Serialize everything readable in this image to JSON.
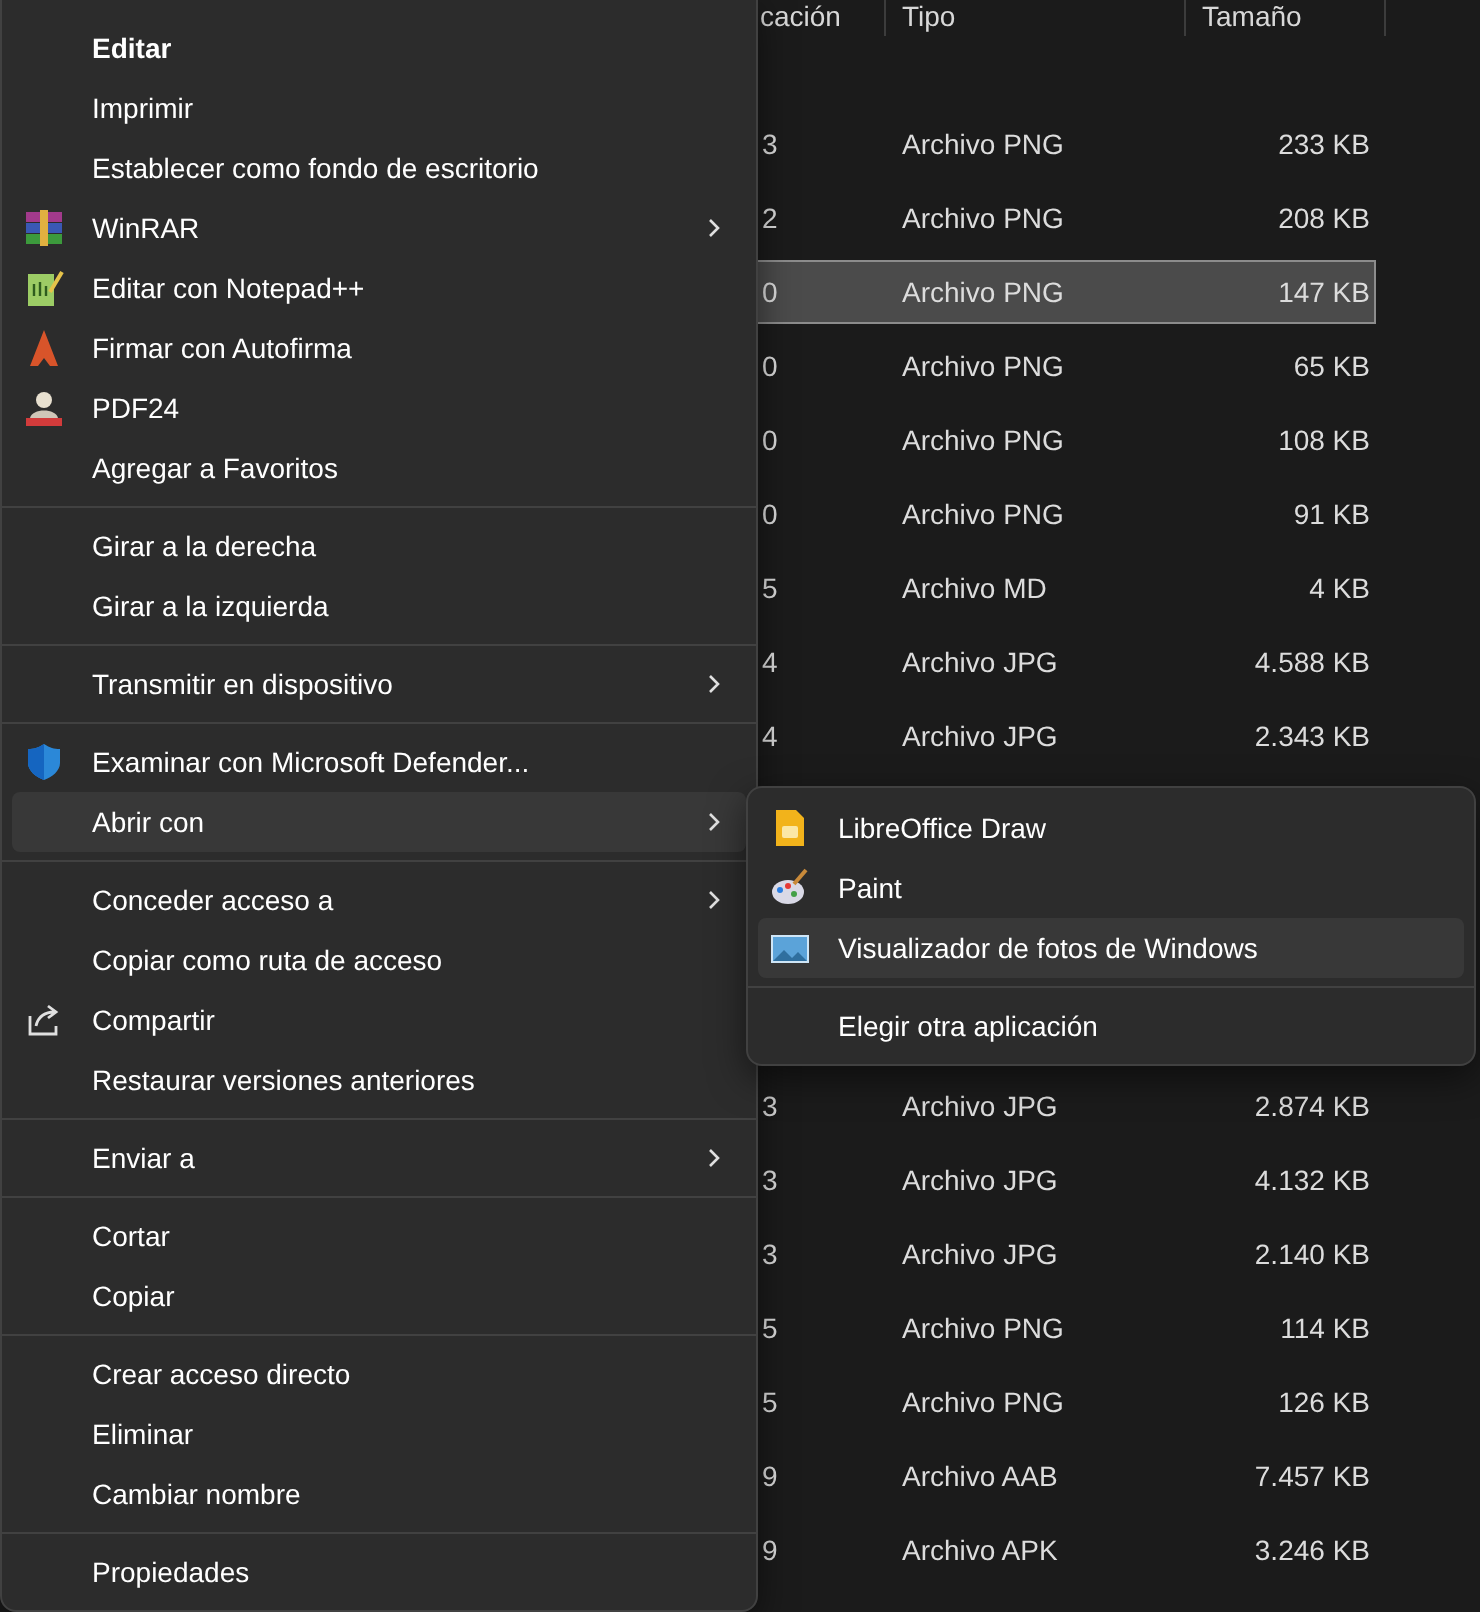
{
  "file_list": {
    "columns": [
      "cación",
      "Tipo",
      "Tamaño"
    ],
    "rows": [
      {
        "column_1": "3",
        "type": "Archivo PNG",
        "size": "233 KB",
        "selected": false
      },
      {
        "column_1": "2",
        "type": "Archivo PNG",
        "size": "208 KB",
        "selected": false
      },
      {
        "column_1": "0",
        "type": "Archivo PNG",
        "size": "147 KB",
        "selected": true
      },
      {
        "column_1": "0",
        "type": "Archivo PNG",
        "size": "65 KB",
        "selected": false
      },
      {
        "column_1": "0",
        "type": "Archivo PNG",
        "size": "108 KB",
        "selected": false
      },
      {
        "column_1": "0",
        "type": "Archivo PNG",
        "size": "91 KB",
        "selected": false
      },
      {
        "column_1": "5",
        "type": "Archivo MD",
        "size": "4 KB",
        "selected": false
      },
      {
        "column_1": "4",
        "type": "Archivo JPG",
        "size": "4.588 KB",
        "selected": false
      },
      {
        "column_1": "4",
        "type": "Archivo JPG",
        "size": "2.343 KB",
        "selected": false
      },
      {
        "column_1": "3",
        "type": "Archivo JPG",
        "size": "2.874 KB",
        "selected": false
      },
      {
        "column_1": "3",
        "type": "Archivo JPG",
        "size": "4.132 KB",
        "selected": false
      },
      {
        "column_1": "3",
        "type": "Archivo JPG",
        "size": "2.140 KB",
        "selected": false
      },
      {
        "column_1": "5",
        "type": "Archivo PNG",
        "size": "114 KB",
        "selected": false
      },
      {
        "column_1": "5",
        "type": "Archivo PNG",
        "size": "126 KB",
        "selected": false
      },
      {
        "column_1": "9",
        "type": "Archivo AAB",
        "size": "7.457 KB",
        "selected": false
      },
      {
        "column_1": "9",
        "type": "Archivo APK",
        "size": "3.246 KB",
        "selected": false
      }
    ]
  },
  "context_menu": {
    "groups": [
      [
        {
          "label": "Editar",
          "kind": "text",
          "bold": true,
          "has_submenu": false,
          "selected": false
        },
        {
          "label": "Imprimir",
          "kind": "text",
          "bold": false,
          "has_submenu": false,
          "selected": false
        },
        {
          "label": "Establecer como fondo de escritorio",
          "kind": "text",
          "bold": false,
          "has_submenu": false,
          "selected": false
        },
        {
          "label": "WinRAR",
          "kind": "icon",
          "bold": false,
          "has_submenu": true,
          "selected": false
        },
        {
          "label": "Editar con Notepad++",
          "kind": "icon",
          "bold": false,
          "has_submenu": false,
          "selected": false
        },
        {
          "label": "Firmar con Autofirma",
          "kind": "icon",
          "bold": false,
          "has_submenu": false,
          "selected": false
        },
        {
          "label": "PDF24",
          "kind": "icon",
          "bold": false,
          "has_submenu": false,
          "selected": false
        },
        {
          "label": "Agregar a Favoritos",
          "kind": "text",
          "bold": false,
          "has_submenu": false,
          "selected": false
        }
      ],
      [
        {
          "label": "Girar a la derecha",
          "kind": "text",
          "bold": false,
          "has_submenu": false,
          "selected": false
        },
        {
          "label": "Girar a la izquierda",
          "kind": "text",
          "bold": false,
          "has_submenu": false,
          "selected": false
        }
      ],
      [
        {
          "label": "Transmitir en dispositivo",
          "kind": "text",
          "bold": false,
          "has_submenu": true,
          "selected": false
        }
      ],
      [
        {
          "label": "Examinar con Microsoft Defender...",
          "kind": "icon",
          "bold": false,
          "has_submenu": false,
          "selected": false
        },
        {
          "label": "Abrir con",
          "kind": "text",
          "bold": false,
          "has_submenu": true,
          "selected": true,
          "children": [
            [
              {
                "label": "LibreOffice Draw",
                "kind": "icon",
                "bold": false,
                "has_submenu": false,
                "selected": false
              },
              {
                "label": "Paint",
                "kind": "icon",
                "bold": false,
                "has_submenu": false,
                "selected": false
              },
              {
                "label": "Visualizador de fotos de Windows",
                "kind": "icon",
                "bold": false,
                "has_submenu": false,
                "selected": true
              }
            ],
            [
              {
                "label": "Elegir otra aplicación",
                "kind": "text",
                "bold": false,
                "has_submenu": false,
                "selected": false
              }
            ]
          ]
        }
      ],
      [
        {
          "label": "Conceder acceso a",
          "kind": "text",
          "bold": false,
          "has_submenu": true,
          "selected": false
        },
        {
          "label": "Copiar como ruta de acceso",
          "kind": "text",
          "bold": false,
          "has_submenu": false,
          "selected": false
        },
        {
          "label": "Compartir",
          "kind": "icon",
          "bold": false,
          "has_submenu": false,
          "selected": false
        },
        {
          "label": "Restaurar versiones anteriores",
          "kind": "text",
          "bold": false,
          "has_submenu": false,
          "selected": false
        }
      ],
      [
        {
          "label": "Enviar a",
          "kind": "text",
          "bold": false,
          "has_submenu": true,
          "selected": false
        }
      ],
      [
        {
          "label": "Cortar",
          "kind": "text",
          "bold": false,
          "has_submenu": false,
          "selected": false
        },
        {
          "label": "Copiar",
          "kind": "text",
          "bold": false,
          "has_submenu": false,
          "selected": false
        }
      ],
      [
        {
          "label": "Crear acceso directo",
          "kind": "text",
          "bold": false,
          "has_submenu": false,
          "selected": false
        },
        {
          "label": "Eliminar",
          "kind": "text",
          "bold": false,
          "has_submenu": false,
          "selected": false
        },
        {
          "label": "Cambiar nombre",
          "kind": "text",
          "bold": false,
          "has_submenu": false,
          "selected": false
        }
      ],
      [
        {
          "label": "Propiedades",
          "kind": "text",
          "bold": false,
          "has_submenu": false,
          "selected": false
        }
      ]
    ]
  }
}
